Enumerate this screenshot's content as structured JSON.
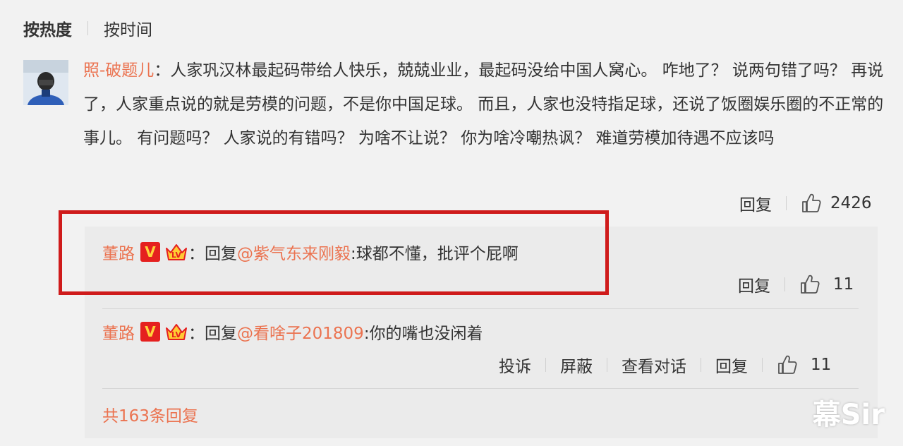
{
  "sort": {
    "active": "按热度",
    "other": "按时间"
  },
  "main_comment": {
    "username": "照-破题儿",
    "separator": "：",
    "text": "人家巩汉林最起码带给人快乐，兢兢业业，最起码没给中国人窝心。 咋地了？ 说两句错了吗？ 再说了，人家重点说的就是劳模的问题，不是你中国足球。 而且，人家也没特指足球，还说了饭圈娱乐圈的不正常的事儿。 有问题吗？ 人家说的有错吗？ 为啥不让说？ 你为啥冷嘲热讽？ 难道劳模加待遇不应该吗",
    "reply_label": "回复",
    "likes": "2426"
  },
  "replies": [
    {
      "username": "董路",
      "badge": "V",
      "separator": "：",
      "reply_prefix": "回复",
      "mention": "@紫气东来刚毅",
      "text": ":球都不懂，批评个屁啊",
      "reply_label": "回复",
      "likes": "11"
    },
    {
      "username": "董路",
      "badge": "V",
      "separator": "：",
      "reply_prefix": "回复",
      "mention": "@看啥子201809",
      "text": ":你的嘴也没闲着",
      "report_label": "投诉",
      "block_label": "屏蔽",
      "view_convo_label": "查看对话",
      "reply_label": "回复",
      "likes": "11"
    }
  ],
  "more_replies": "共163条回复",
  "watermark": "幕Sir",
  "colors": {
    "accent": "#eb7350",
    "highlight": "#cf1b1b",
    "badge": "#e5201f"
  },
  "icons": {
    "like": "thumbs-up-icon",
    "badge": "verified-v-icon",
    "crown": "crown-level-icon"
  }
}
